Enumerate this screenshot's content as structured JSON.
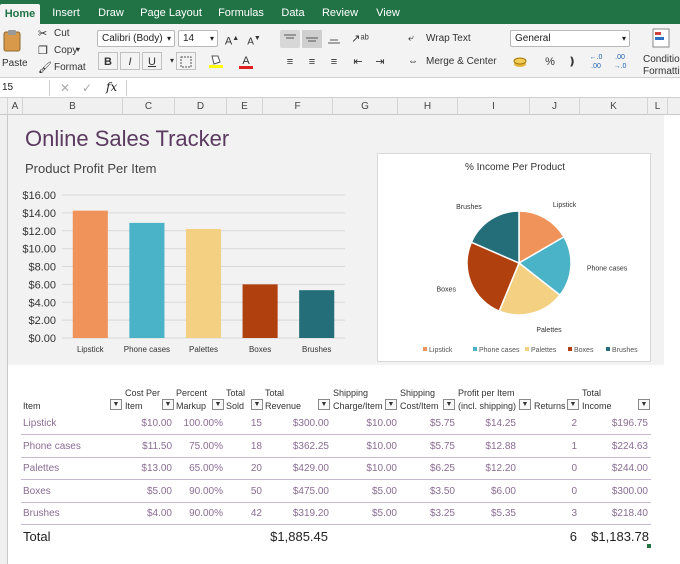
{
  "ribbon": {
    "tabs": [
      "Home",
      "Insert",
      "Draw",
      "Page Layout",
      "Formulas",
      "Data",
      "Review",
      "View"
    ],
    "paste": "Paste",
    "cut": "Cut",
    "copy": "Copy",
    "format": "Format",
    "font_name": "Calibri (Body)",
    "font_size": "14",
    "wrap_text": "Wrap Text",
    "merge_center": "Merge & Center",
    "number_format": "General",
    "percent": "%",
    "conditional_1": "Condition",
    "conditional_2": "Formattin",
    "bold": "B",
    "italic": "I",
    "underline": "U",
    "font_color": "#e02020",
    "fill_color": "#ffff00"
  },
  "formula_bar": {
    "name_box": "15",
    "fx": "fx",
    "value": ""
  },
  "columns": [
    "A",
    "B",
    "C",
    "D",
    "E",
    "F",
    "G",
    "H",
    "I",
    "J",
    "K",
    "L"
  ],
  "dashboard": {
    "title": "Online Sales Tracker",
    "subtitle": "Product Profit Per Item"
  },
  "chart_data": [
    {
      "type": "bar",
      "title": "Product Profit Per Item",
      "categories": [
        "Lipstick",
        "Phone cases",
        "Palettes",
        "Boxes",
        "Brushes"
      ],
      "values": [
        14.25,
        12.88,
        12.2,
        6.0,
        5.35
      ],
      "colors": [
        "#f0935a",
        "#4bb3c7",
        "#f3d082",
        "#b1400f",
        "#236e78"
      ],
      "ylim": [
        0,
        16
      ],
      "yticks": [
        "$0.00",
        "$2.00",
        "$4.00",
        "$6.00",
        "$8.00",
        "$10.00",
        "$12.00",
        "$14.00",
        "$16.00"
      ],
      "grid": true
    },
    {
      "type": "pie",
      "title": "% Income Per Product",
      "categories": [
        "Lipstick",
        "Phone cases",
        "Palettes",
        "Boxes",
        "Brushes"
      ],
      "values": [
        196.75,
        224.63,
        244.0,
        300.0,
        218.4
      ],
      "colors": [
        "#f0935a",
        "#4bb3c7",
        "#f3d082",
        "#b1400f",
        "#236e78"
      ],
      "legend": "bottom"
    }
  ],
  "table": {
    "headers": [
      [
        "",
        "Item"
      ],
      [
        "Cost Per",
        "Item"
      ],
      [
        "Percent",
        "Markup"
      ],
      [
        "Total",
        "Sold"
      ],
      [
        "Total",
        "Revenue"
      ],
      [
        "Shipping",
        "Charge/Item"
      ],
      [
        "Shipping",
        "Cost/Item"
      ],
      [
        "Profit per Item",
        "(incl. shipping)"
      ],
      [
        "",
        "Returns"
      ],
      [
        "Total",
        "Income"
      ]
    ],
    "rows": [
      [
        "Lipstick",
        "$10.00",
        "100.00%",
        "15",
        "$300.00",
        "$10.00",
        "$5.75",
        "$14.25",
        "2",
        "$196.75"
      ],
      [
        "Phone cases",
        "$11.50",
        "75.00%",
        "18",
        "$362.25",
        "$10.00",
        "$5.75",
        "$12.88",
        "1",
        "$224.63"
      ],
      [
        "Palettes",
        "$13.00",
        "65.00%",
        "20",
        "$429.00",
        "$10.00",
        "$6.25",
        "$12.20",
        "0",
        "$244.00"
      ],
      [
        "Boxes",
        "$5.00",
        "90.00%",
        "50",
        "$475.00",
        "$5.00",
        "$3.50",
        "$6.00",
        "0",
        "$300.00"
      ],
      [
        "Brushes",
        "$4.00",
        "90.00%",
        "42",
        "$319.20",
        "$5.00",
        "$3.25",
        "$5.35",
        "3",
        "$218.40"
      ]
    ],
    "total_label": "Total",
    "total_revenue": "$1,885.45",
    "total_returns": "6",
    "total_income": "$1,183.78"
  }
}
